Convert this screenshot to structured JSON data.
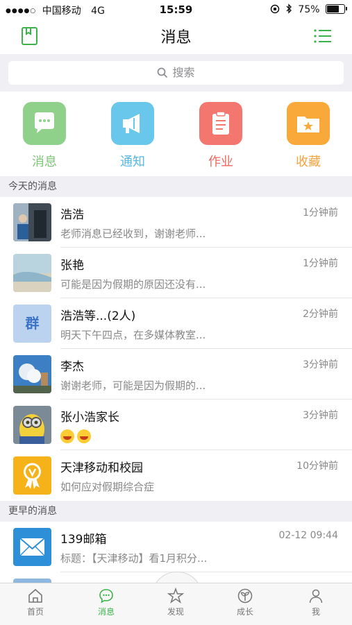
{
  "status_bar": {
    "carrier": "中国移动",
    "network": "4G",
    "time": "15:59",
    "battery": "75%",
    "battery_level": 0.75
  },
  "nav": {
    "title": "消息",
    "left_icon": "address-book-icon",
    "right_icon": "list-menu-icon"
  },
  "search": {
    "placeholder": "搜索"
  },
  "quick_actions": [
    {
      "label": "消息",
      "icon": "chat-bubble-icon",
      "color": "#8fd18a",
      "label_color": "#7cc576"
    },
    {
      "label": "通知",
      "icon": "megaphone-icon",
      "color": "#6ac7ec",
      "label_color": "#56b8e6"
    },
    {
      "label": "作业",
      "icon": "clipboard-icon",
      "color": "#f3776f",
      "label_color": "#ef6a5f"
    },
    {
      "label": "收藏",
      "icon": "star-folder-icon",
      "color": "#f9a93a",
      "label_color": "#f5a43c"
    }
  ],
  "sections": {
    "today": "今天的消息",
    "earlier": "更早的消息"
  },
  "messages_today": [
    {
      "name": "浩浩",
      "time": "1分钟前",
      "preview": "老师消息已经收到，谢谢老师..."
    },
    {
      "name": "张艳",
      "time": "1分钟前",
      "preview": "可能是因为假期的原因还没有..."
    },
    {
      "name": "浩浩等...(2人)",
      "time": "2分钟前",
      "preview": "明天下午四点，在多媒体教室...",
      "avatar_text": "群"
    },
    {
      "name": "李杰",
      "time": "3分钟前",
      "preview": "谢谢老师，可能是因为假期的..."
    },
    {
      "name": "张小浩家长",
      "time": "3分钟前",
      "preview": ""
    },
    {
      "name": "天津移动和校园",
      "time": "10分钟前",
      "preview": "如何应对假期综合症"
    }
  ],
  "messages_earlier": [
    {
      "name": "139邮箱",
      "time": "02-12 09:44",
      "preview": "标题：【天津移动】看1月积分..."
    }
  ],
  "tabs": [
    {
      "label": "首页",
      "icon": "home-icon"
    },
    {
      "label": "消息",
      "icon": "chat-icon",
      "active": true
    },
    {
      "label": "发现",
      "icon": "discover-star-icon"
    },
    {
      "label": "成长",
      "icon": "sprout-icon"
    },
    {
      "label": "我",
      "icon": "person-icon"
    }
  ],
  "colors": {
    "accent": "#3cb34a",
    "background": "#efeff4"
  }
}
